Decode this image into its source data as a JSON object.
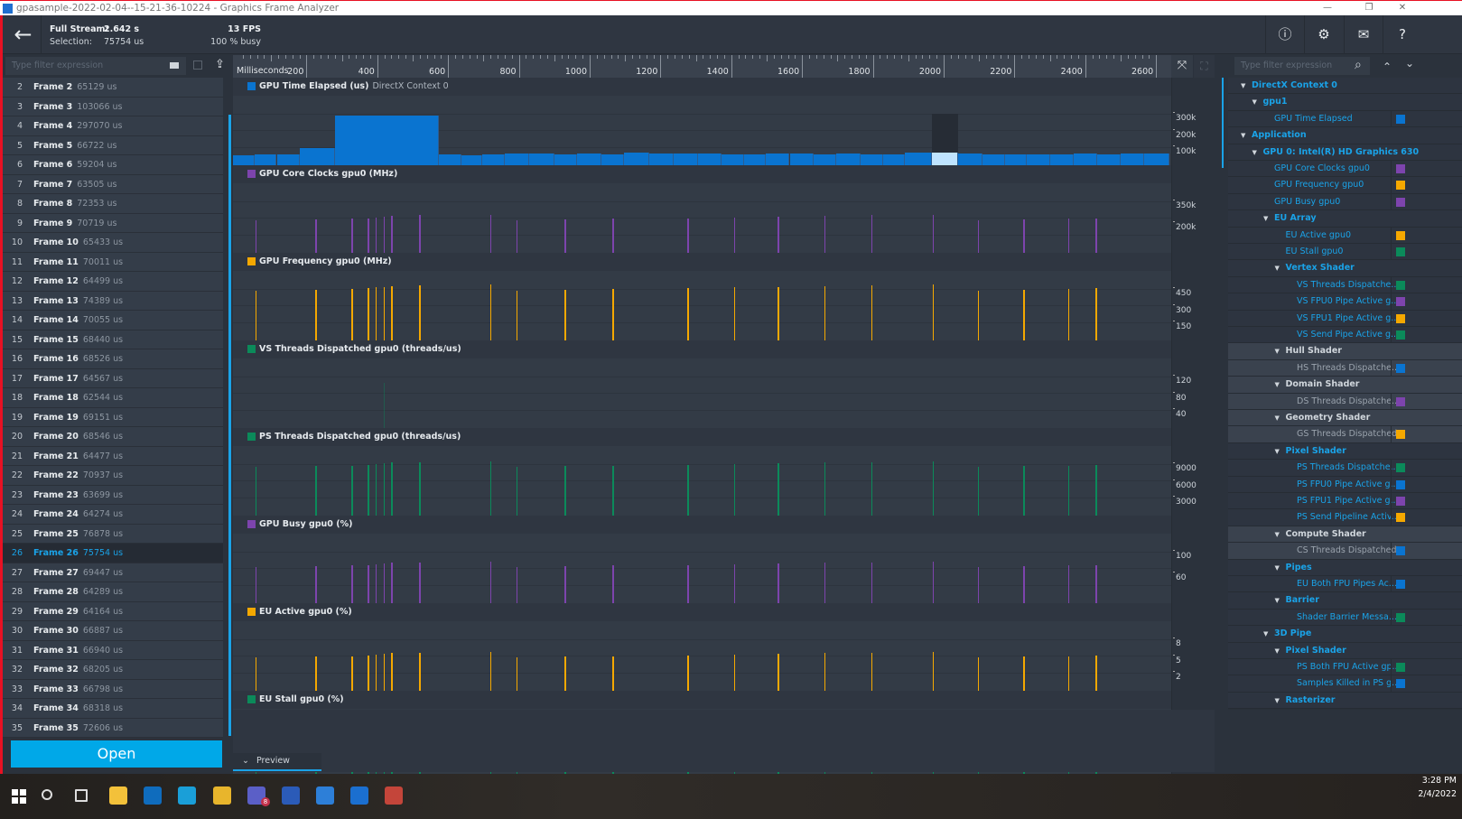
{
  "window": {
    "title": "gpasample-2022-02-04--15-21-36-10224 - Graphics Frame Analyzer",
    "minimize": "—",
    "restore": "❐",
    "close": "✕"
  },
  "header": {
    "back_icon": "arrow-left",
    "full_stream_label": "Full Stream:",
    "full_stream_value": "2.642 s",
    "selection_label": "Selection:",
    "selection_value": "75754 us",
    "fps": "13 FPS",
    "busy": "100 % busy",
    "icons": {
      "info": "ⓘ",
      "settings": "⚙",
      "mail": "✉",
      "help": "?"
    }
  },
  "left_toolbar": {
    "filter_placeholder": "Type filter expression"
  },
  "timeline": {
    "unit_label": "Milliseconds",
    "ticks": [
      200,
      400,
      600,
      800,
      1000,
      1200,
      1400,
      1600,
      1800,
      2000,
      2200,
      2400,
      2600
    ],
    "range_ms": [
      0,
      2642
    ]
  },
  "frames": [
    {
      "idx": "2",
      "name": "Frame 2",
      "dur": "65129 us"
    },
    {
      "idx": "3",
      "name": "Frame 3",
      "dur": "103066 us"
    },
    {
      "idx": "4",
      "name": "Frame 4",
      "dur": "297070 us"
    },
    {
      "idx": "5",
      "name": "Frame 5",
      "dur": "66722 us"
    },
    {
      "idx": "6",
      "name": "Frame 6",
      "dur": "59204 us"
    },
    {
      "idx": "7",
      "name": "Frame 7",
      "dur": "63505 us"
    },
    {
      "idx": "8",
      "name": "Frame 8",
      "dur": "72353 us"
    },
    {
      "idx": "9",
      "name": "Frame 9",
      "dur": "70719 us"
    },
    {
      "idx": "10",
      "name": "Frame 10",
      "dur": "65433 us"
    },
    {
      "idx": "11",
      "name": "Frame 11",
      "dur": "70011 us"
    },
    {
      "idx": "12",
      "name": "Frame 12",
      "dur": "64499 us"
    },
    {
      "idx": "13",
      "name": "Frame 13",
      "dur": "74389 us"
    },
    {
      "idx": "14",
      "name": "Frame 14",
      "dur": "70055 us"
    },
    {
      "idx": "15",
      "name": "Frame 15",
      "dur": "68440 us"
    },
    {
      "idx": "16",
      "name": "Frame 16",
      "dur": "68526 us"
    },
    {
      "idx": "17",
      "name": "Frame 17",
      "dur": "64567 us"
    },
    {
      "idx": "18",
      "name": "Frame 18",
      "dur": "62544 us"
    },
    {
      "idx": "19",
      "name": "Frame 19",
      "dur": "69151 us"
    },
    {
      "idx": "20",
      "name": "Frame 20",
      "dur": "68546 us"
    },
    {
      "idx": "21",
      "name": "Frame 21",
      "dur": "64477 us"
    },
    {
      "idx": "22",
      "name": "Frame 22",
      "dur": "70937 us"
    },
    {
      "idx": "23",
      "name": "Frame 23",
      "dur": "63699 us"
    },
    {
      "idx": "24",
      "name": "Frame 24",
      "dur": "64274 us"
    },
    {
      "idx": "25",
      "name": "Frame 25",
      "dur": "76878 us"
    },
    {
      "idx": "26",
      "name": "Frame 26",
      "dur": "75754 us",
      "selected": true
    },
    {
      "idx": "27",
      "name": "Frame 27",
      "dur": "69447 us"
    },
    {
      "idx": "28",
      "name": "Frame 28",
      "dur": "64289 us"
    },
    {
      "idx": "29",
      "name": "Frame 29",
      "dur": "64164 us"
    },
    {
      "idx": "30",
      "name": "Frame 30",
      "dur": "66887 us"
    },
    {
      "idx": "31",
      "name": "Frame 31",
      "dur": "66940 us"
    },
    {
      "idx": "32",
      "name": "Frame 32",
      "dur": "68205 us"
    },
    {
      "idx": "33",
      "name": "Frame 33",
      "dur": "66798 us"
    },
    {
      "idx": "34",
      "name": "Frame 34",
      "dur": "68318 us"
    },
    {
      "idx": "35",
      "name": "Frame 35",
      "dur": "72606 us"
    }
  ],
  "open_button": "Open",
  "preview_label": "Preview",
  "chart_data": {
    "type": "bar",
    "x_unit": "ms",
    "selected_frame": "26",
    "gpu_time_us": [
      62000,
      64000,
      65129,
      103066,
      297070,
      66722,
      59204,
      63505,
      72353,
      70719,
      65433,
      70011,
      64499,
      74389,
      70055,
      68440,
      68526,
      64567,
      62544,
      69151,
      68546,
      64477,
      70937,
      63699,
      64274,
      76878,
      75754,
      69447,
      64289,
      64164,
      66887,
      66940,
      68205,
      66798,
      68318,
      72606
    ],
    "spike_times_ms": [
      61,
      230,
      332,
      378,
      400,
      423,
      444,
      523,
      724,
      798,
      934,
      1069,
      1281,
      1413,
      1536,
      1668,
      1801,
      1974,
      2102,
      2230,
      2357,
      2434
    ],
    "tracks": [
      {
        "title": "GPU Time Elapsed (us)",
        "subtitle": "DirectX Context 0",
        "color": "#0a74d0",
        "yticks": [
          "300k",
          "200k",
          "100k"
        ],
        "kind": "bars",
        "ymax": 400000
      },
      {
        "title": "GPU Core Clocks gpu0 (MHz)",
        "color": "#7d44ad",
        "yticks": [
          "350k",
          "200k"
        ],
        "kind": "spikes",
        "level": 0.47
      },
      {
        "title": "GPU Frequency gpu0 (MHz)",
        "color": "#f5a800",
        "yticks": [
          "450",
          "300",
          "150"
        ],
        "kind": "spikes",
        "level": 0.72
      },
      {
        "title": "VS Threads Dispatched gpu0 (threads/us)",
        "color": "#0b8a5a",
        "yticks": [
          "120",
          "80",
          "40"
        ],
        "kind": "spikes",
        "level": 0.0
      },
      {
        "title": "PS Threads Dispatched gpu0 (threads/us)",
        "color": "#0b8a5a",
        "yticks": [
          "9000",
          "6000",
          "3000"
        ],
        "kind": "spikes",
        "level": 0.7
      },
      {
        "title": "GPU Busy gpu0 (%)",
        "color": "#7d44ad",
        "yticks": [
          "100",
          "60"
        ],
        "kind": "spikes",
        "level": 0.52
      },
      {
        "title": "EU Active gpu0 (%)",
        "color": "#f5a800",
        "yticks": [
          "8",
          "5",
          "2"
        ],
        "kind": "spikes",
        "level": 0.48
      },
      {
        "title": "EU Stall gpu0 (%)",
        "color": "#0b8a5a",
        "yticks": [],
        "kind": "spikes",
        "level": 0.4
      }
    ]
  },
  "right_toolbar": {
    "filter_placeholder": "Type filter expression",
    "search_icon": "⌕",
    "up": "⌃",
    "down": "⌄"
  },
  "tree": [
    {
      "label": "DirectX Context 0",
      "level": 0,
      "group": true
    },
    {
      "label": "gpu1",
      "level": 1,
      "group": true
    },
    {
      "label": "GPU Time Elapsed",
      "level": 2,
      "color": "#0a74d0"
    },
    {
      "label": "Application",
      "level": 0,
      "group": true
    },
    {
      "label": "GPU 0: Intel(R) HD Graphics 630",
      "level": 1,
      "group": true
    },
    {
      "label": "GPU Core Clocks gpu0",
      "level": 2,
      "color": "#7d44ad"
    },
    {
      "label": "GPU Frequency gpu0",
      "level": 2,
      "color": "#f5a800"
    },
    {
      "label": "GPU Busy gpu0",
      "level": 2,
      "color": "#7d44ad"
    },
    {
      "label": "EU Array",
      "level": 2,
      "group": true
    },
    {
      "label": "EU Active gpu0",
      "level": 3,
      "color": "#f5a800"
    },
    {
      "label": "EU Stall gpu0",
      "level": 3,
      "color": "#0b8a5a"
    },
    {
      "label": "Vertex Shader",
      "level": 3,
      "group": true
    },
    {
      "label": "VS Threads Dispatche...",
      "level": 4,
      "color": "#0b8a5a"
    },
    {
      "label": "VS FPU0 Pipe Active g...",
      "level": 4,
      "color": "#7d44ad"
    },
    {
      "label": "VS FPU1 Pipe Active g...",
      "level": 4,
      "color": "#f5a800"
    },
    {
      "label": "VS Send Pipe Active g...",
      "level": 4,
      "color": "#0b8a5a"
    },
    {
      "label": "Hull Shader",
      "level": 3,
      "group": true,
      "disabled": true
    },
    {
      "label": "HS Threads Dispatche...",
      "level": 4,
      "color": "#0a74d0",
      "disabled": true
    },
    {
      "label": "Domain Shader",
      "level": 3,
      "group": true,
      "disabled": true
    },
    {
      "label": "DS Threads Dispatche...",
      "level": 4,
      "color": "#7d44ad",
      "disabled": true
    },
    {
      "label": "Geometry Shader",
      "level": 3,
      "group": true,
      "disabled": true
    },
    {
      "label": "GS Threads Dispatched...",
      "level": 4,
      "color": "#f5a800",
      "disabled": true
    },
    {
      "label": "Pixel Shader",
      "level": 3,
      "group": true
    },
    {
      "label": "PS Threads Dispatche...",
      "level": 4,
      "color": "#0b8a5a"
    },
    {
      "label": "PS FPU0 Pipe Active g...",
      "level": 4,
      "color": "#0a74d0"
    },
    {
      "label": "PS FPU1 Pipe Active g...",
      "level": 4,
      "color": "#7d44ad"
    },
    {
      "label": "PS Send Pipeline Activ...",
      "level": 4,
      "color": "#f5a800"
    },
    {
      "label": "Compute Shader",
      "level": 3,
      "group": true,
      "disabled": true
    },
    {
      "label": "CS Threads Dispatched...",
      "level": 4,
      "color": "#0a74d0",
      "disabled": true
    },
    {
      "label": "Pipes",
      "level": 3,
      "group": true
    },
    {
      "label": "EU Both FPU Pipes Ac...",
      "level": 4,
      "color": "#0a74d0"
    },
    {
      "label": "Barrier",
      "level": 3,
      "group": true
    },
    {
      "label": "Shader Barrier Messa...",
      "level": 4,
      "color": "#0b8a5a"
    },
    {
      "label": "3D Pipe",
      "level": 2,
      "group": true
    },
    {
      "label": "Pixel Shader",
      "level": 3,
      "group": true
    },
    {
      "label": "PS Both FPU Active gp...",
      "level": 4,
      "color": "#0b8a5a"
    },
    {
      "label": "Samples Killed in PS g...",
      "level": 4,
      "color": "#0a74d0"
    },
    {
      "label": "Rasterizer",
      "level": 3,
      "group": true
    }
  ],
  "taskbar": {
    "icons": [
      "windows-start",
      "search",
      "task-view",
      "file-explorer",
      "outlook",
      "edge",
      "chrome",
      "teams",
      "word",
      "notes",
      "graphics-analyzer",
      "snagit"
    ],
    "teams_badge": "8",
    "time": "3:28 PM",
    "date": "2/4/2022"
  }
}
